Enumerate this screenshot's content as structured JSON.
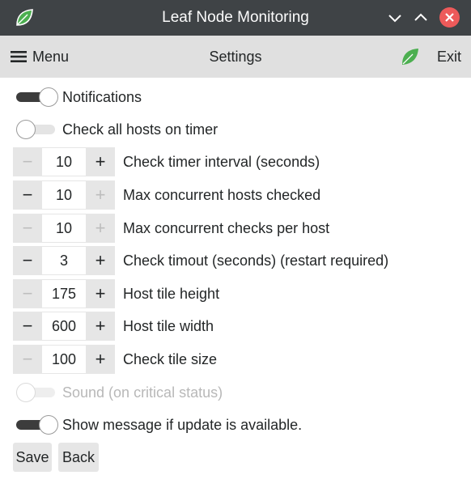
{
  "window": {
    "title": "Leaf Node Monitoring",
    "app_icon": "leaf-icon",
    "buttons": [
      "minimize-icon",
      "maximize-icon",
      "close-icon"
    ],
    "close_color": "#ed5a5a"
  },
  "toolbar": {
    "menu_label": "Menu",
    "title": "Settings",
    "exit_label": "Exit",
    "bg": "#e0e0e0"
  },
  "settings": {
    "notifications": {
      "label": "Notifications",
      "state": "on"
    },
    "check_all_hosts": {
      "label": "Check all hosts on timer",
      "state": "off"
    },
    "steppers": [
      {
        "label": "Check timer interval (seconds)",
        "value": "10",
        "minus_enabled": false,
        "plus_enabled": true
      },
      {
        "label": "Max concurrent hosts checked",
        "value": "10",
        "minus_enabled": true,
        "plus_enabled": false
      },
      {
        "label": "Max concurrent checks per host",
        "value": "10",
        "minus_enabled": false,
        "plus_enabled": false
      },
      {
        "label": "Check timout (seconds) (restart required)",
        "value": "3",
        "minus_enabled": true,
        "plus_enabled": true
      },
      {
        "label": "Host tile height",
        "value": "175",
        "minus_enabled": false,
        "plus_enabled": true
      },
      {
        "label": "Host tile width",
        "value": "600",
        "minus_enabled": true,
        "plus_enabled": true
      },
      {
        "label": "Check tile size",
        "value": "100",
        "minus_enabled": false,
        "plus_enabled": true
      }
    ],
    "sound": {
      "label": "Sound (on critical status)",
      "state": "off",
      "disabled": true
    },
    "update_message": {
      "label": "Show message if update is available.",
      "state": "on"
    }
  },
  "actions": {
    "save_label": "Save",
    "back_label": "Back"
  },
  "glyphs": {
    "minus": "−",
    "plus": "+"
  },
  "colors": {
    "titlebar": "#3f4346",
    "leaf_green": "#4caf50",
    "toggle_on": "#3c3c3c"
  }
}
